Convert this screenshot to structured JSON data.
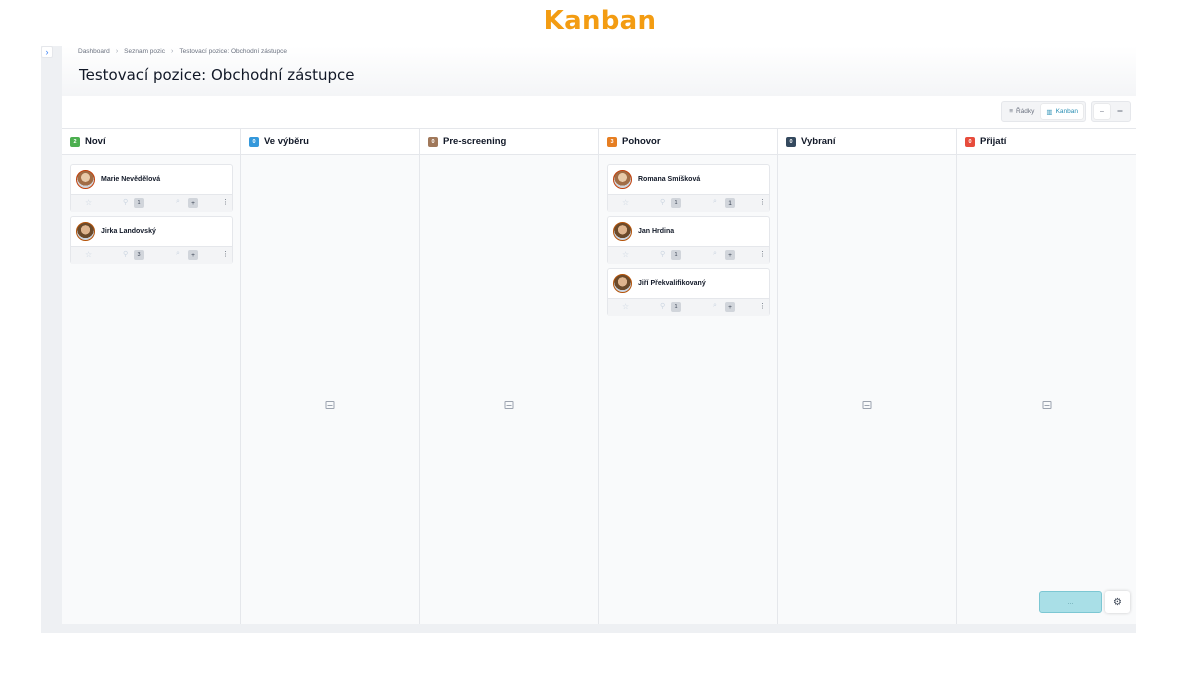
{
  "hero_title": "Kanban",
  "breadcrumb": {
    "items": [
      "Dashboard",
      "Seznam pozic",
      "Testovací pozice: Obchodní zástupce"
    ]
  },
  "page_title": "Testovací pozice: Obchodní zástupce",
  "view_toggle": {
    "rows_label": "Řádky",
    "kanban_label": "Kanban",
    "active": "Kanban"
  },
  "density": {
    "compact_icon": "–",
    "comfortable_icon": "═"
  },
  "columns": [
    {
      "title": "Noví",
      "count": "2",
      "color": "#4caf50"
    },
    {
      "title": "Ve výběru",
      "count": "0",
      "color": "#3498db"
    },
    {
      "title": "Pre-screening",
      "count": "0",
      "color": "#a0785a"
    },
    {
      "title": "Pohovor",
      "count": "3",
      "color": "#e67e22"
    },
    {
      "title": "Vybraní",
      "count": "0",
      "color": "#34495e"
    },
    {
      "title": "Přijatí",
      "count": "0",
      "color": "#e74c3c"
    }
  ],
  "cards": {
    "novi": [
      {
        "name": "Marie Nevědělová",
        "attachments": "1",
        "comments": "+"
      },
      {
        "name": "Jirka Landovský",
        "attachments": "3",
        "comments": "+"
      }
    ],
    "pohovor": [
      {
        "name": "Romana Smíšková",
        "attachments": "1",
        "comments": "1"
      },
      {
        "name": "Jan Hrdina",
        "attachments": "1",
        "comments": "+"
      },
      {
        "name": "Jiří Překvalifikovaný",
        "attachments": "1",
        "comments": "+"
      }
    ]
  },
  "fab": {
    "main_label": "...",
    "gear_icon": "⚙"
  },
  "icons": {
    "star": "☆",
    "clip": "⚲",
    "chat": "⌕",
    "menu": "⋮",
    "chevron": "›",
    "rows": "≡",
    "kanban": "▥"
  }
}
